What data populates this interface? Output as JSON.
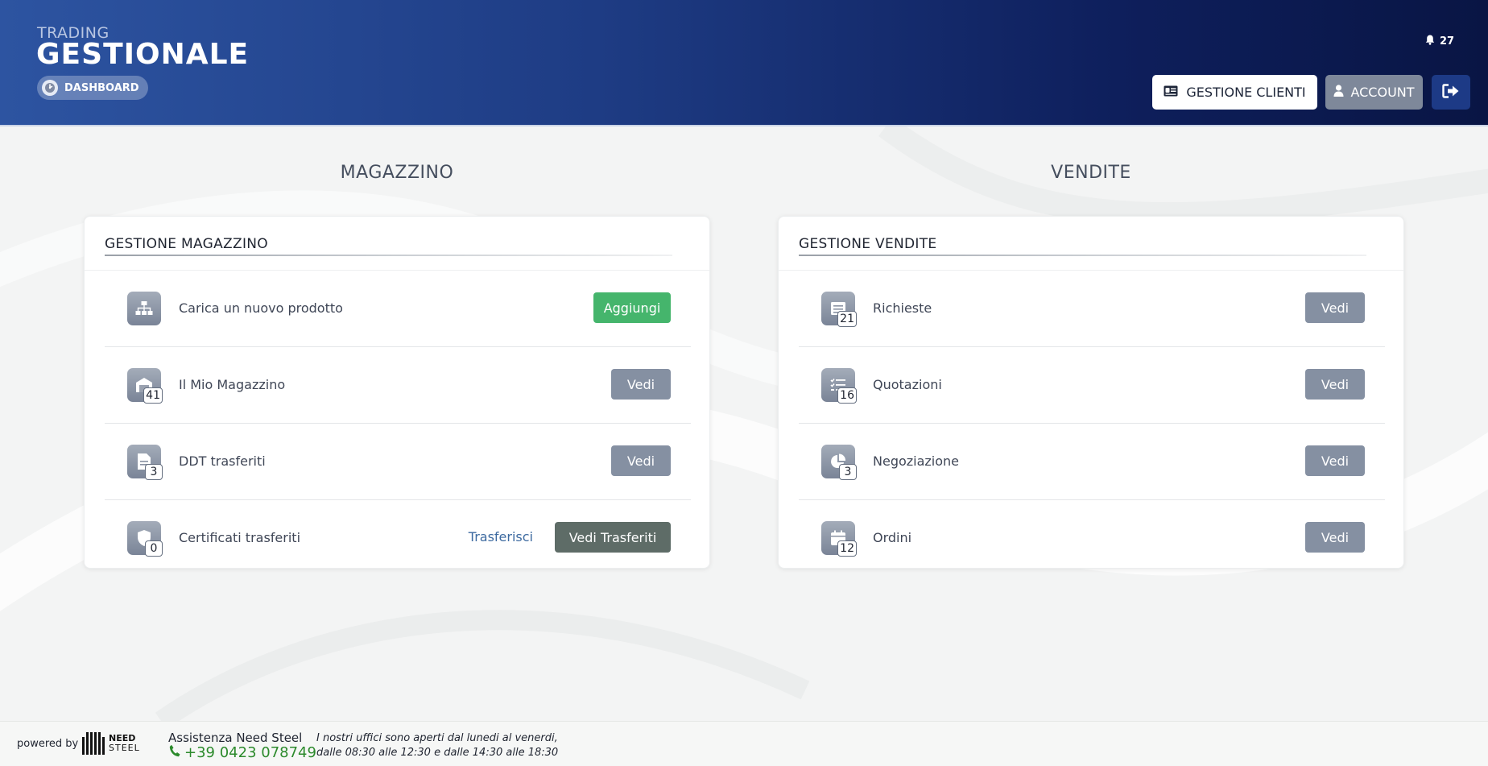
{
  "header": {
    "brand_top": "TRADING",
    "brand_main": "GESTIONALE",
    "dashboard_label": "DASHBOARD",
    "notifications_count": "27",
    "clienti_label": "GESTIONE CLIENTI",
    "account_label": "ACCOUNT"
  },
  "magazzino": {
    "section_title": "MAGAZZINO",
    "card_title": "GESTIONE MAGAZZINO",
    "rows": [
      {
        "label": "Carica un nuovo prodotto",
        "button": "Aggiungi",
        "icon": "sitemap-icon"
      },
      {
        "label": "Il Mio Magazzino",
        "badge": "41",
        "button": "Vedi",
        "icon": "warehouse-icon"
      },
      {
        "label": "DDT trasferiti",
        "badge": "3",
        "button": "Vedi",
        "icon": "document-icon"
      },
      {
        "label": "Certificati trasferiti",
        "badge": "0",
        "link": "Trasferisci",
        "button": "Vedi Trasferiti",
        "icon": "shield-icon"
      }
    ]
  },
  "vendite": {
    "section_title": "VENDITE",
    "card_title": "GESTIONE VENDITE",
    "rows": [
      {
        "label": "Richieste",
        "badge": "21",
        "button": "Vedi",
        "icon": "list-icon"
      },
      {
        "label": "Quotazioni",
        "badge": "16",
        "button": "Vedi",
        "icon": "checklist-icon"
      },
      {
        "label": "Negoziazione",
        "badge": "3",
        "button": "Vedi",
        "icon": "pie-icon"
      },
      {
        "label": "Ordini",
        "badge": "12",
        "button": "Vedi",
        "icon": "calendar-icon"
      }
    ]
  },
  "footer": {
    "powered_by": "powered by",
    "logo_line1": "NEED",
    "logo_line2": "STEEL",
    "assist_title": "Assistenza Need Steel",
    "phone": "+39 0423 078749",
    "hours_line1": "I nostri uffici sono aperti dal lunedi al venerdi,",
    "hours_line2": "dalle 08:30 alle 12:30 e dalle 14:30 alle 18:30"
  },
  "colors": {
    "header_start": "#2d54a1",
    "header_end": "#091544",
    "accent_green": "#45b56c",
    "button_gray": "#8590a2",
    "phone_green": "#2c8a2c"
  }
}
